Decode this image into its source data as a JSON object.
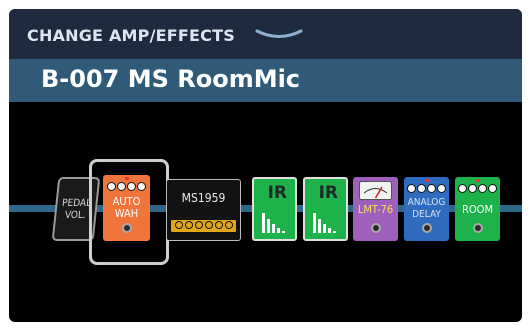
{
  "header": {
    "title": "CHANGE AMP/EFFECTS"
  },
  "patch": {
    "name": "B-007 MS RoomMic"
  },
  "chain": {
    "pedal_vol": {
      "label_line1": "PEDAL",
      "label_line2": "VOL."
    },
    "auto_wah": {
      "label_line1": "AUTO",
      "label_line2": "WAH",
      "color": "#f0753a"
    },
    "amp": {
      "label": "MS1959",
      "color": "#e0a818"
    },
    "ir1": {
      "label": "IR",
      "color": "#1eb34a"
    },
    "ir2": {
      "label": "IR",
      "color": "#1eb34a"
    },
    "lmt": {
      "label": "LMT-76",
      "color": "#9e5fbd"
    },
    "analog_delay": {
      "label_line1": "ANALOG",
      "label_line2": "DELAY",
      "color": "#2f6bbf"
    },
    "room": {
      "label": "ROOM",
      "color": "#1eb34a"
    }
  },
  "icons": {
    "header": "chevron-down-icon",
    "ir": "impulse-response-icon",
    "meter": "vu-meter-icon",
    "footswitch": "footswitch-icon"
  }
}
